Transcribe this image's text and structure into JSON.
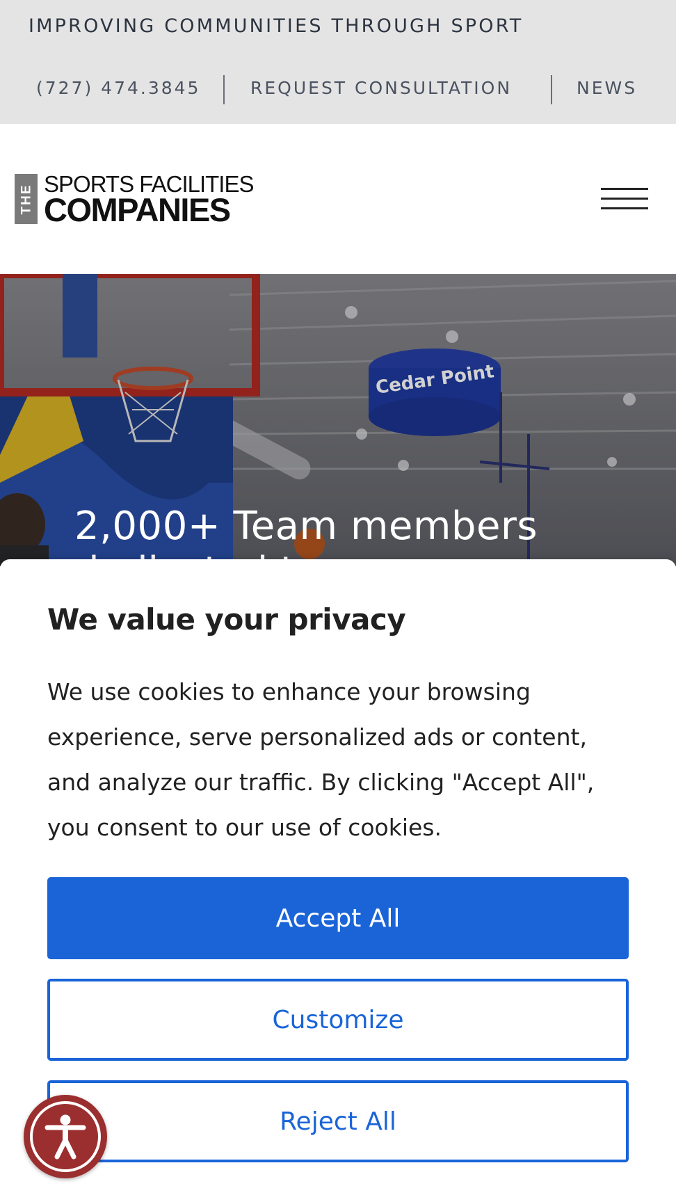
{
  "topbar": {
    "tagline": "IMPROVING COMMUNITIES THROUGH SPORT",
    "phone": "(727) 474.3845",
    "consultation": "REQUEST CONSULTATION",
    "news": "NEWS"
  },
  "logo": {
    "the": "THE",
    "line1": "SPORTS FACILITIES",
    "line2": "COMPANIES"
  },
  "hero": {
    "banner_text": "Cedar Point",
    "headline_line1": "2,000+ Team members",
    "headline_line2": "dedicated to"
  },
  "consent": {
    "title": "We value your privacy",
    "body": "We use cookies to enhance your browsing experience, serve personalized ads or content, and analyze our traffic. By clicking \"Accept All\", you consent to our use of cookies.",
    "accept_label": "Accept All",
    "customize_label": "Customize",
    "reject_label": "Reject All"
  },
  "colors": {
    "accent": "#1a64d8",
    "topbar_bg": "#e4e4e4",
    "a11y_bg": "#9b2e2e"
  },
  "icons": {
    "menu": "hamburger-icon",
    "accessibility": "accessibility-person-icon"
  }
}
